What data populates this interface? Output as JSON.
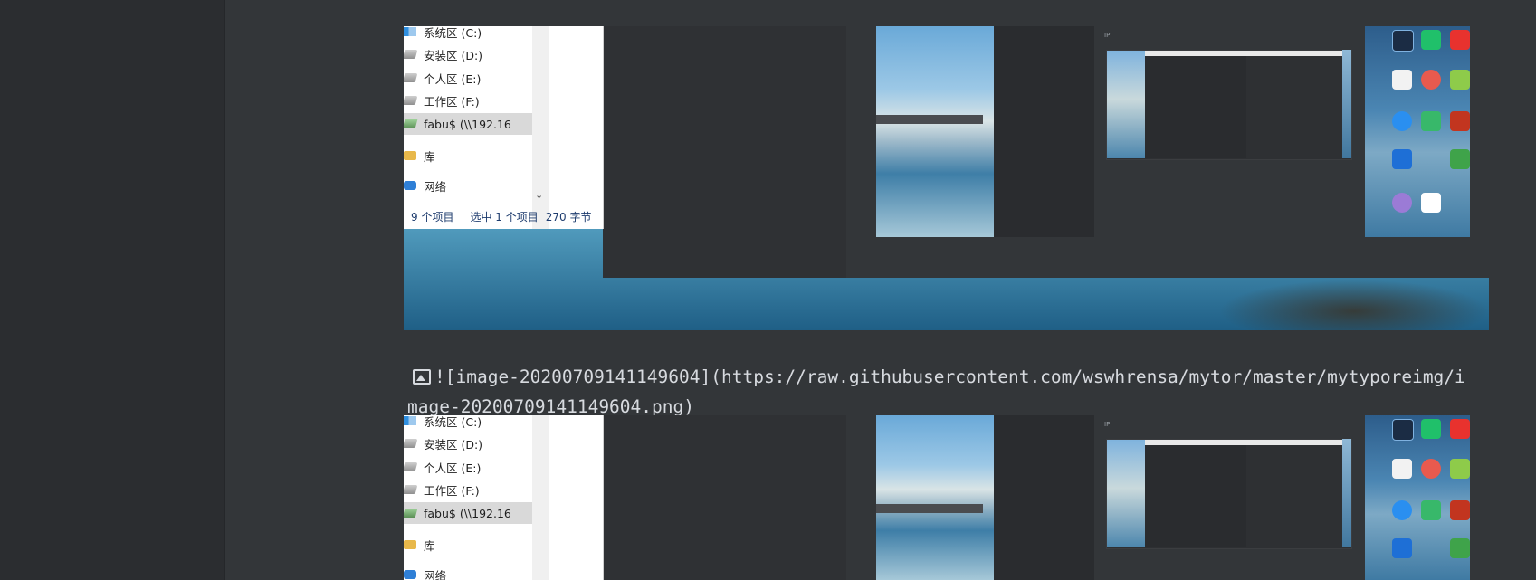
{
  "explorer": {
    "tree_items": [
      {
        "label": "系统区 (C:)",
        "icon": "system-drive-icon"
      },
      {
        "label": "安装区 (D:)",
        "icon": "drive-icon"
      },
      {
        "label": "个人区 (E:)",
        "icon": "drive-icon"
      },
      {
        "label": "工作区 (F:)",
        "icon": "drive-icon"
      },
      {
        "label": "fabu$ (\\\\192.16",
        "icon": "network-drive-icon",
        "selected": true
      },
      {
        "label": "库",
        "icon": "library-icon"
      },
      {
        "label": "网络",
        "icon": "network-icon"
      }
    ],
    "status": {
      "count": "9 个项目",
      "selection": "选中 1 个项目",
      "size": "270 字节"
    }
  },
  "markdown": {
    "line1": "![image-20200709141149604](https://raw.githubusercontent.com/wswhrensa/mytor/master/mytyporeimg/i",
    "line2": "mage-20200709141149604.png)"
  },
  "colors": {
    "background": "#333639",
    "gutter": "#2b2d30",
    "text": "#d7dadf",
    "explorer_status_text": "#1e3c6e"
  }
}
